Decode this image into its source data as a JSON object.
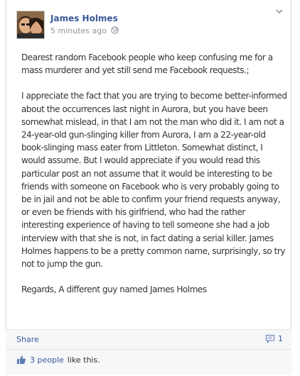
{
  "post": {
    "author": "James Holmes",
    "timestamp": "5 minutes ago",
    "privacy_icon": "globe-icon",
    "paragraphs": [
      "Dearest random Facebook people who keep confusing me for a mass murderer and yet still send me Facebook requests.;",
      "I appreciate the fact that you are trying to become better-informed about the occurrences last night in Aurora, but you have been somewhat mislead, in that I am not the man who did it. I am not a 24-year-old gun-slinging killer from Aurora, I am a 22-year-old book-slinging mass eater from Littleton. Somewhat distinct, I would assume. But I would appreciate if you would read this particular post an not assume that it would be interesting to be friends with someone on Facebook who is very probably going to be in jail and not be able to confirm your friend requests anyway, or even be friends with his girlfriend, who had the rather interesting experience of having to tell someone she had a job interview with that she is not, in fact dating a serial killer. James Holmes happens to be a pretty common name, surprisingly, so try not to jump the gun.",
      "Regards, A different guy named James Holmes"
    ]
  },
  "footer": {
    "share_label": "Share",
    "comment_count": "1",
    "likes_count_label": "3 people",
    "likes_suffix": "like this."
  },
  "colors": {
    "link": "#3b5998",
    "text": "#333333",
    "meta": "#90949c",
    "footer_bg": "#f6f7f9"
  }
}
